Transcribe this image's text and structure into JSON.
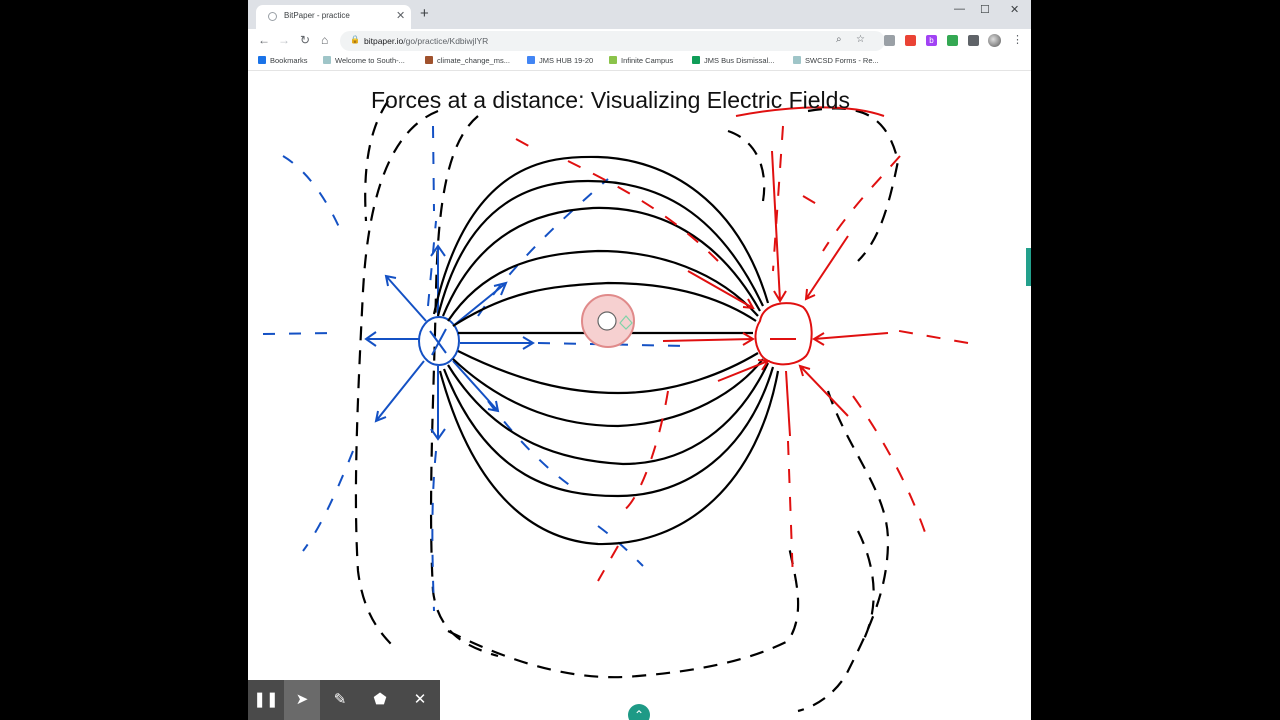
{
  "browser": {
    "tab": {
      "title": "BitPaper - practice",
      "close_icon": "close-icon"
    },
    "new_tab_label": "+",
    "window_controls": [
      "—",
      "☐",
      "✕"
    ],
    "url": {
      "host": "bitpaper.io",
      "path": "/go/practice/KdbiwjlYR"
    },
    "bookmarks": [
      {
        "label": "Bookmarks",
        "color": "#1a73e8",
        "icon": "star-icon"
      },
      {
        "label": "Welcome to South-...",
        "color": "#9fc5c8",
        "icon": "shield-icon"
      },
      {
        "label": "climate_change_ms...",
        "color": "#a0522d",
        "icon": "badge-icon"
      },
      {
        "label": "JMS HUB 19-20",
        "color": "#4285f4",
        "icon": "doc-icon"
      },
      {
        "label": "Infinite Campus",
        "color": "#8bc34a",
        "icon": "campus-icon"
      },
      {
        "label": "JMS Bus Dismissal...",
        "color": "#0f9d58",
        "icon": "sheet-icon"
      },
      {
        "label": "SWCSD Forms - Re...",
        "color": "#9fc5c8",
        "icon": "shield-icon"
      }
    ]
  },
  "board": {
    "title": "Forces at a distance: Visualizing Electric Fields",
    "colors": {
      "positive": "#1451c4",
      "negative": "#e01010",
      "field": "#000000"
    }
  },
  "toolbox": {
    "tools": [
      {
        "name": "pause-button",
        "glyph": "❚❚"
      },
      {
        "name": "select-tool",
        "glyph": "➤"
      },
      {
        "name": "pen-tool",
        "glyph": "✎"
      },
      {
        "name": "eraser-tool",
        "glyph": "⬟"
      },
      {
        "name": "close-tool",
        "glyph": "✕"
      }
    ]
  },
  "expand_glyph": "⌃"
}
